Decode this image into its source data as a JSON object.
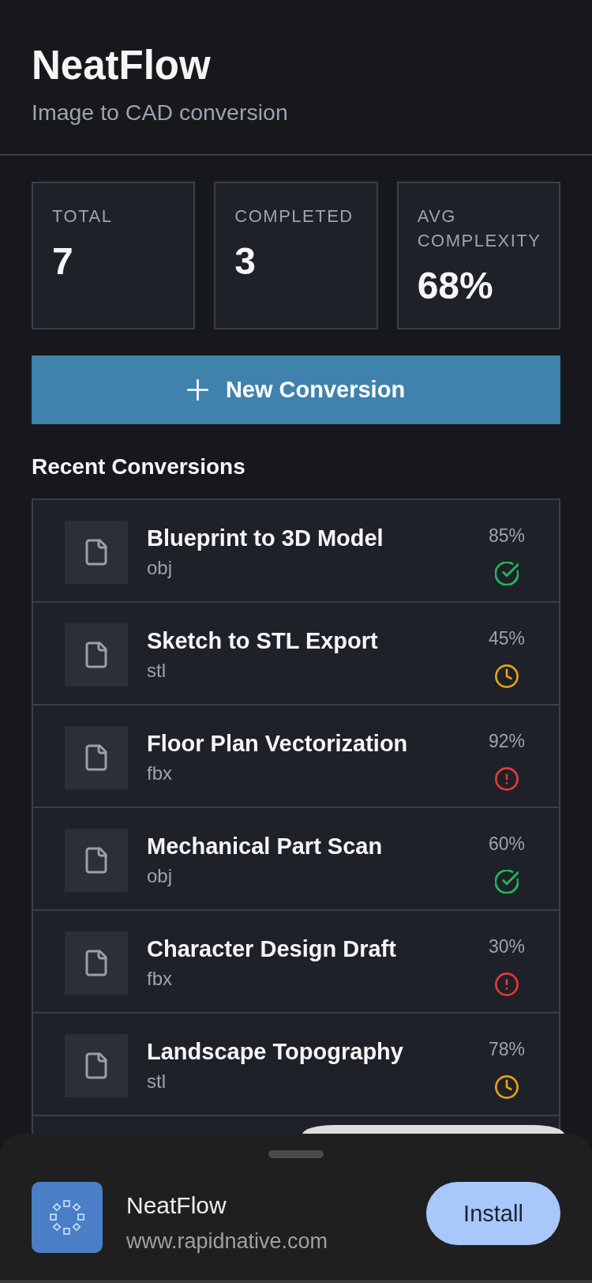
{
  "header": {
    "title": "NeatFlow",
    "subtitle": "Image to CAD conversion"
  },
  "stats": [
    {
      "label": "TOTAL",
      "value": "7"
    },
    {
      "label": "COMPLETED",
      "value": "3"
    },
    {
      "label": "AVG COMPLEXITY",
      "value": "68%"
    }
  ],
  "new_button": {
    "label": "New Conversion"
  },
  "recent": {
    "title": "Recent Conversions",
    "items": [
      {
        "title": "Blueprint to 3D Model",
        "format": "obj",
        "percent": "85%",
        "kind": "completed"
      },
      {
        "title": "Sketch to STL Export",
        "format": "stl",
        "percent": "45%",
        "kind": "pending"
      },
      {
        "title": "Floor Plan Vectorization",
        "format": "fbx",
        "percent": "92%",
        "kind": "failed"
      },
      {
        "title": "Mechanical Part Scan",
        "format": "obj",
        "percent": "60%",
        "kind": "completed"
      },
      {
        "title": "Character Design Draft",
        "format": "fbx",
        "percent": "30%",
        "kind": "failed"
      },
      {
        "title": "Landscape Topography",
        "format": "stl",
        "percent": "78%",
        "kind": "pending"
      }
    ]
  },
  "install_banner": {
    "app_name": "NeatFlow",
    "url": "www.rapidnative.com",
    "button": "Install"
  }
}
